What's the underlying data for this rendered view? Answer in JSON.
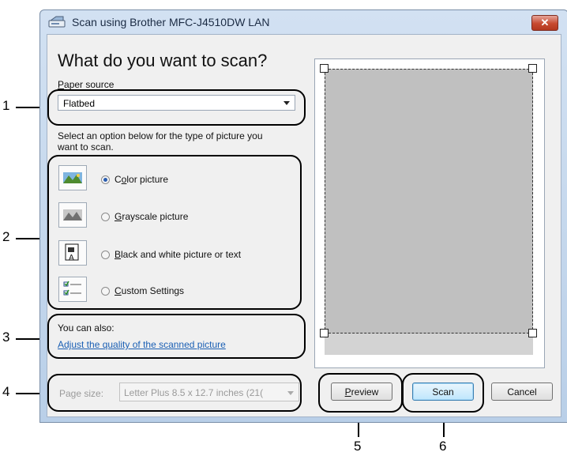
{
  "window": {
    "title": "Scan using Brother MFC-J4510DW LAN",
    "close_label": "✕"
  },
  "heading": "What do you want to scan?",
  "paper_source": {
    "label_prefix": "",
    "label_underlined": "P",
    "label_rest": "aper source",
    "value": "Flatbed"
  },
  "instruction": [
    "Select an option below for the type of picture you",
    "want to scan."
  ],
  "options": [
    {
      "u": "o",
      "pre": "C",
      "rest": "lor picture",
      "selected": true
    },
    {
      "u": "G",
      "pre": "",
      "rest": "rayscale picture",
      "selected": false
    },
    {
      "u": "B",
      "pre": "",
      "rest": "lack and white picture or text",
      "selected": false
    },
    {
      "u": "C",
      "pre": "",
      "rest": "ustom Settings",
      "selected": false
    }
  ],
  "also_label": "You can also:",
  "adjust_link": "Adjust the quality of the scanned picture",
  "page_size": {
    "label": "Page size:",
    "value": "Letter Plus 8.5 x 12.7 inches (21("
  },
  "buttons": {
    "preview_u": "P",
    "preview_rest": "review",
    "scan": "Scan",
    "cancel": "Cancel"
  },
  "callouts": [
    "1",
    "2",
    "3",
    "4",
    "5",
    "6"
  ]
}
